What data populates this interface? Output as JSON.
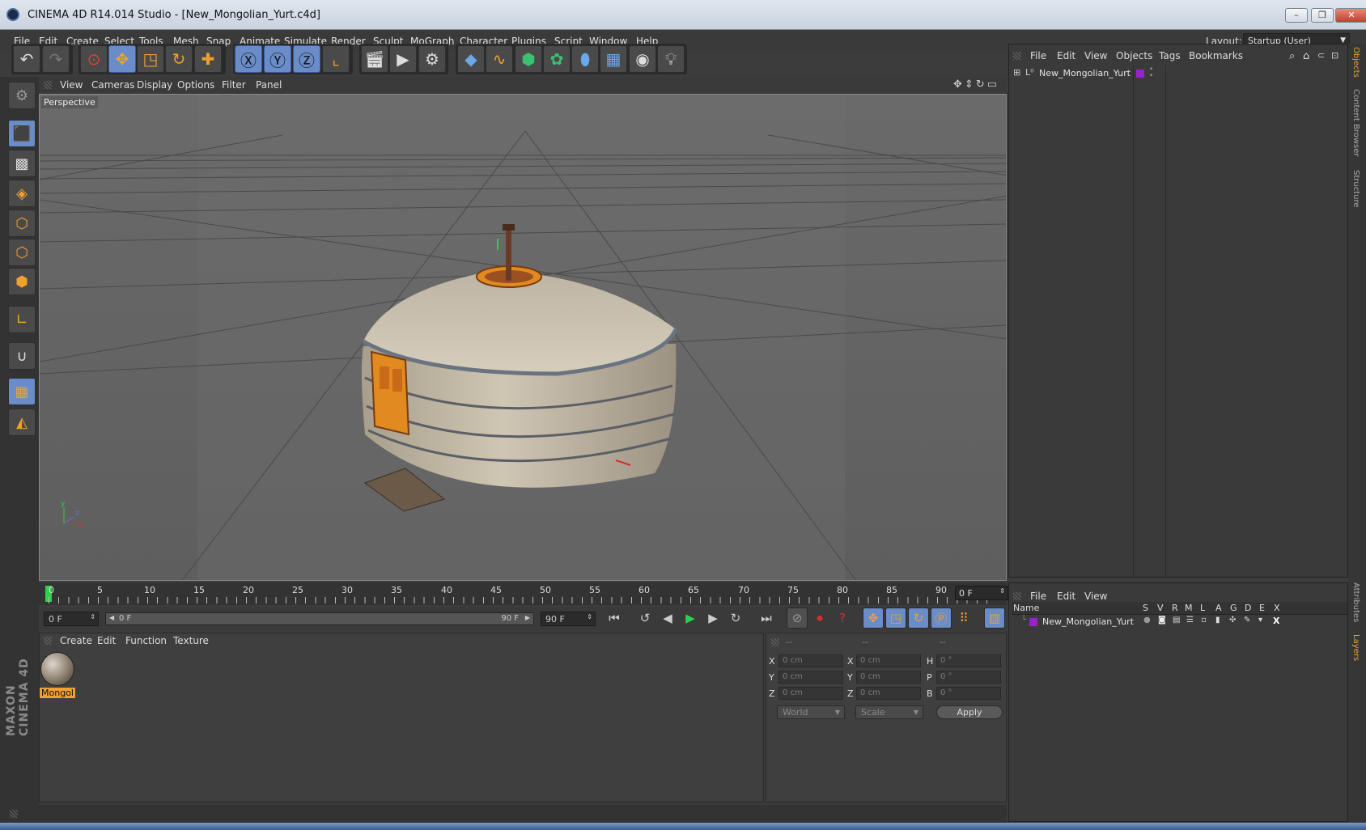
{
  "window": {
    "title": "CINEMA 4D R14.014 Studio - [New_Mongolian_Yurt.c4d]",
    "controls": [
      "–",
      "❐",
      "✕"
    ]
  },
  "menubar": {
    "items": [
      "File",
      "Edit",
      "Create",
      "Select",
      "Tools",
      "Mesh",
      "Snap",
      "Animate",
      "Simulate",
      "Render",
      "Sculpt",
      "MoGraph",
      "Character",
      "Plugins",
      "Script",
      "Window",
      "Help"
    ],
    "layout_label": "Layout:",
    "layout_value": "Startup (User)"
  },
  "viewport": {
    "menu": [
      "View",
      "Cameras",
      "Display",
      "Options",
      "Filter",
      "Panel"
    ],
    "label": "Perspective",
    "axis_x": "x",
    "axis_y": "y",
    "axis_z": "z"
  },
  "timeline": {
    "ticks": [
      "0",
      "5",
      "10",
      "15",
      "20",
      "25",
      "30",
      "35",
      "40",
      "45",
      "50",
      "55",
      "60",
      "65",
      "70",
      "75",
      "80",
      "85",
      "90"
    ],
    "current_frame": "0 F",
    "start_field": "0 F",
    "slider_left": "0 F",
    "slider_right": "90 F",
    "end_field": "90 F"
  },
  "materials": {
    "menu": [
      "Create",
      "Edit",
      "Function",
      "Texture"
    ],
    "items": [
      {
        "label": "Mongol"
      }
    ]
  },
  "coordinates": {
    "headers": [
      "--",
      "--",
      "--"
    ],
    "rows": [
      {
        "l1": "X",
        "v1": "0 cm",
        "l2": "X",
        "v2": "0 cm",
        "l3": "H",
        "v3": "0 °"
      },
      {
        "l1": "Y",
        "v1": "0 cm",
        "l2": "Y",
        "v2": "0 cm",
        "l3": "P",
        "v3": "0 °"
      },
      {
        "l1": "Z",
        "v1": "0 cm",
        "l2": "Z",
        "v2": "0 cm",
        "l3": "B",
        "v3": "0 °"
      }
    ],
    "mode": "World",
    "type": "Scale",
    "apply": "Apply"
  },
  "objects": {
    "menu": [
      "File",
      "Edit",
      "View",
      "Objects",
      "Tags",
      "Bookmarks"
    ],
    "items": [
      {
        "name": "New_Mongolian_Yurt",
        "color": "#9a22cc"
      }
    ]
  },
  "layers": {
    "menu": [
      "File",
      "Edit",
      "View"
    ],
    "columns": [
      "Name",
      "S",
      "V",
      "R",
      "M",
      "L",
      "A",
      "G",
      "D",
      "E",
      "X"
    ],
    "items": [
      {
        "name": "New_Mongolian_Yurt",
        "color": "#9a22cc"
      }
    ]
  },
  "side_tabs": {
    "objects": "Objects",
    "content_browser": "Content Browser",
    "structure": "Structure",
    "attributes": "Attributes",
    "layers": "Layers"
  },
  "branding": "MAXON CINEMA 4D"
}
